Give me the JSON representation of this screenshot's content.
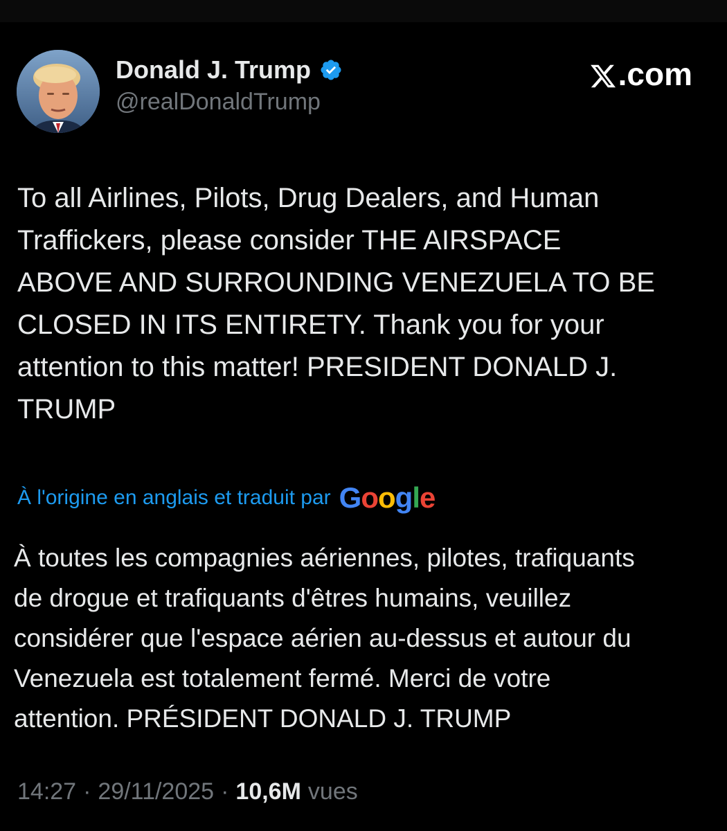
{
  "header": {
    "display_name": "Donald J. Trump",
    "handle": "@realDonaldTrump",
    "brand": "X.com",
    "brand_text": ".com",
    "verified_color": "#1d9bf0"
  },
  "tweet": {
    "text": "To all Airlines, Pilots, Drug Dealers, and Human\nTraffickers, please consider THE AIRSPACE\nABOVE AND SURROUNDING VENEZUELA TO BE\nCLOSED IN ITS ENTIRETY. Thank you for your\nattention to this matter! PRESIDENT DONALD J.\nTRUMP"
  },
  "translation": {
    "label": "À l'origine en anglais et traduit par",
    "provider_letters": [
      {
        "char": "G",
        "color": "#4285F4"
      },
      {
        "char": "o",
        "color": "#EA4335"
      },
      {
        "char": "o",
        "color": "#FBBC05"
      },
      {
        "char": "g",
        "color": "#4285F4"
      },
      {
        "char": "l",
        "color": "#34A853"
      },
      {
        "char": "e",
        "color": "#EA4335"
      }
    ],
    "text": "À toutes les compagnies aériennes, pilotes, trafiquants\nde drogue et trafiquants d'êtres humains, veuillez\nconsidérer que l'espace aérien au-dessus et autour du\nVenezuela est totalement fermé. Merci de votre\nattention. PRÉSIDENT DONALD J. TRUMP"
  },
  "meta": {
    "time": "14:27",
    "separator": "·",
    "date": "29/11/2025",
    "views_count": "10,6M",
    "views_label": "vues"
  },
  "icons": {
    "avatar": "avatar-photo",
    "verified": "verified-badge-icon",
    "brand": "x-logo-icon"
  }
}
